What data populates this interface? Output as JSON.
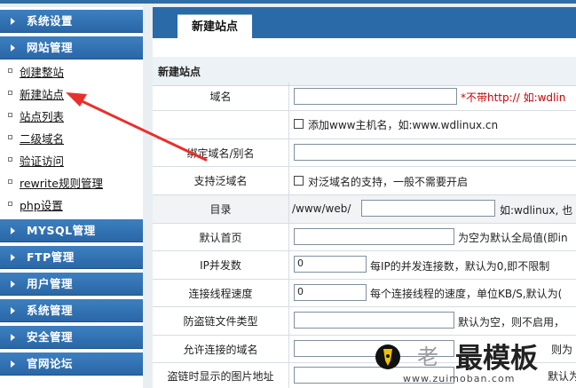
{
  "sidebar": {
    "sections": [
      {
        "label": "系统设置"
      },
      {
        "label": "网站管理"
      },
      {
        "label": "MYSQL管理"
      },
      {
        "label": "FTP管理"
      },
      {
        "label": "用户管理"
      },
      {
        "label": "系统管理"
      },
      {
        "label": "安全管理"
      },
      {
        "label": "官网论坛"
      }
    ],
    "site_items": [
      {
        "label": "创建整站"
      },
      {
        "label": "新建站点"
      },
      {
        "label": "站点列表"
      },
      {
        "label": "二级域名"
      },
      {
        "label": "验证访问"
      },
      {
        "label": "rewrite规则管理"
      },
      {
        "label": "php设置"
      }
    ]
  },
  "main": {
    "tab_label": "新建站点",
    "form_title": "新建站点",
    "rows": {
      "domain": {
        "label": "域名",
        "value": "",
        "hint": "*不带http:// 如:wdlin"
      },
      "www": {
        "label": "",
        "checkbox_text": "添加www主机名，如:www.wdlinux.cn"
      },
      "alias": {
        "label": "绑定域名/别名",
        "value": ""
      },
      "wildcard": {
        "label": "支持泛域名",
        "checkbox_text": "对泛域名的支持，一般不需要开启"
      },
      "dir": {
        "label": "目录",
        "prefix": "/www/web/",
        "value": "",
        "hint": "如:wdlinux, 也"
      },
      "index": {
        "label": "默认首页",
        "value": "",
        "hint": "为空为默认全局值(即in"
      },
      "ip_conn": {
        "label": "IP并发数",
        "value": "0",
        "hint": "每IP的并发连接数，默认为0,即不限制"
      },
      "speed": {
        "label": "连接线程速度",
        "value": "0",
        "hint": "每个连接线程的速度，单位KB/S,默认为("
      },
      "hotlink_types": {
        "label": "防盗链文件类型",
        "value": "",
        "hint": "默认为空，则不启用，"
      },
      "allowed_domains": {
        "label": "允许连接的域名",
        "value": "",
        "hint": "则为"
      },
      "hotlink_image": {
        "label": "盗链时显示的图片地址",
        "value": "",
        "hint": "默认为"
      }
    }
  },
  "watermark": {
    "text1": "老",
    "text2": "最模板",
    "url": "www.zuimoban.com"
  },
  "colors": {
    "accent": "#2b6aa8",
    "annotation_arrow": "#e8302b",
    "hint_red": "#cc0000"
  }
}
